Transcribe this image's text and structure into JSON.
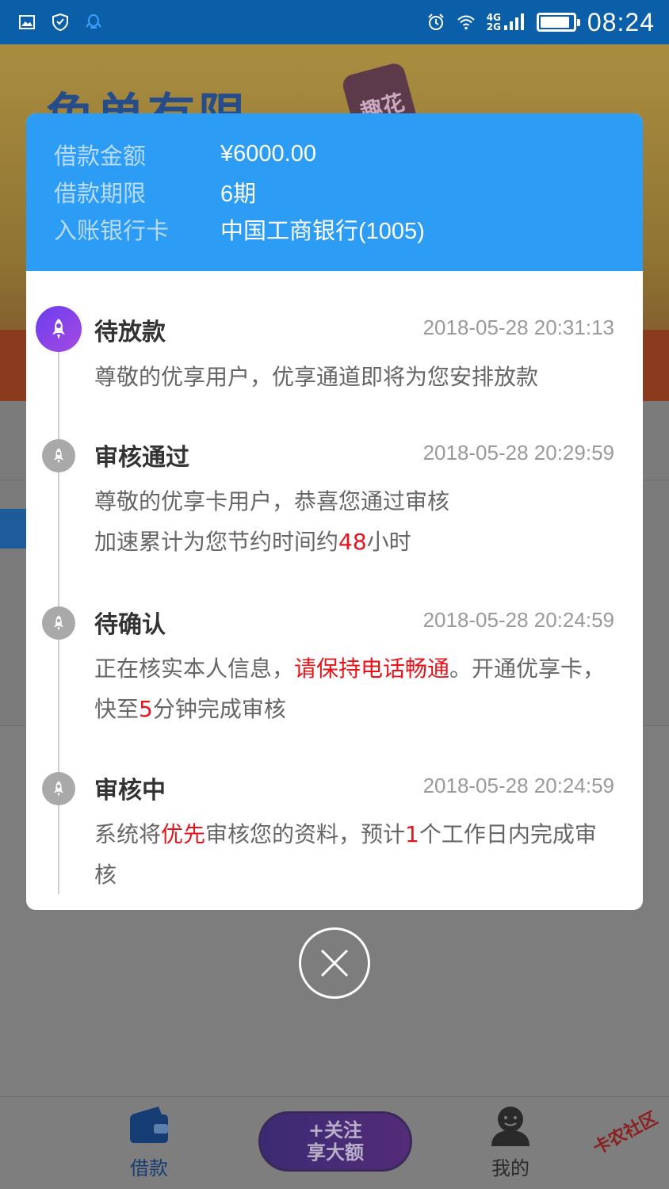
{
  "status_bar": {
    "time": "08:24",
    "network_top": "4G",
    "network_bottom": "2G",
    "battery_level": 0.9,
    "icons": [
      "gallery-icon",
      "shield-icon",
      "qq-icon",
      "alarm-icon",
      "wifi-icon",
      "signal-icon",
      "battery-icon"
    ]
  },
  "background": {
    "banner_text": "免单有限",
    "banner_logo": "趣花"
  },
  "loan_info": {
    "amount_label": "借款金额",
    "amount_value": "¥6000.00",
    "term_label": "借款期限",
    "term_value": "6期",
    "card_label": "入账银行卡",
    "card_value": "中国工商银行(1005)"
  },
  "timeline": [
    {
      "title": "待放款",
      "time": "2018-05-28 20:31:13",
      "desc_parts": [
        {
          "text": "尊敬的优享用户，优享通道即将为您安排放款",
          "hl": false
        }
      ]
    },
    {
      "title": "审核通过",
      "time": "2018-05-28 20:29:59",
      "desc_lines": [
        [
          {
            "text": "尊敬的优享卡用户，恭喜您通过审核",
            "hl": false
          }
        ],
        [
          {
            "text": "加速累计为您节约时间约",
            "hl": false
          },
          {
            "text": "48",
            "hl": true
          },
          {
            "text": "小时",
            "hl": false
          }
        ]
      ]
    },
    {
      "title": "待确认",
      "time": "2018-05-28 20:24:59",
      "desc_parts": [
        {
          "text": "正在核实本人信息，",
          "hl": false
        },
        {
          "text": "请保持电话畅通",
          "hl": true
        },
        {
          "text": "。开通优享卡，快至",
          "hl": false
        },
        {
          "text": "5",
          "hl": true
        },
        {
          "text": "分钟完成审核",
          "hl": false
        }
      ]
    },
    {
      "title": "审核中",
      "time": "2018-05-28 20:24:59",
      "desc_parts": [
        {
          "text": "系统将",
          "hl": false
        },
        {
          "text": "优先",
          "hl": true
        },
        {
          "text": "审核您的资料，预计",
          "hl": false
        },
        {
          "text": "1",
          "hl": true
        },
        {
          "text": "个工作日内完成审核",
          "hl": false
        }
      ]
    }
  ],
  "tabbar": {
    "loan_label": "借款",
    "follow_line1": "+关注",
    "follow_line2": "享大额",
    "mine_label": "我的"
  },
  "watermark": "卡农社区",
  "colors": {
    "header_blue": "#2d9cf5",
    "status_blue": "#0b5fa8",
    "highlight_red": "#e8141c",
    "active_node": "#7b42ec"
  }
}
